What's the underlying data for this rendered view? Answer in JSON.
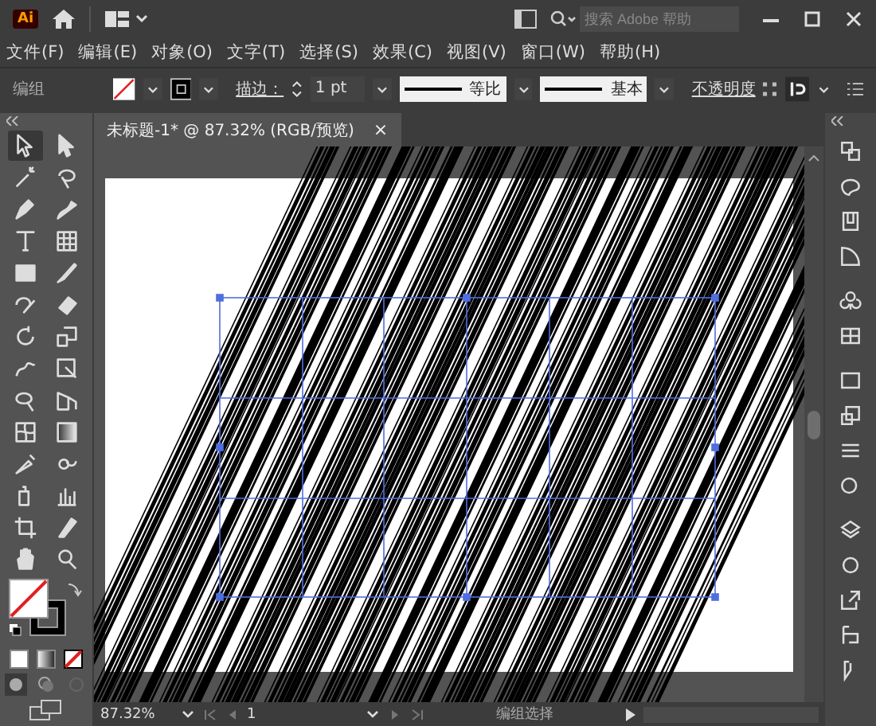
{
  "app": {
    "logo": "Ai",
    "search_placeholder": "搜索 Adobe 帮助"
  },
  "menu": [
    "文件(F)",
    "编辑(E)",
    "对象(O)",
    "文字(T)",
    "选择(S)",
    "效果(C)",
    "视图(V)",
    "窗口(W)",
    "帮助(H)"
  ],
  "control_bar": {
    "selection": "编组",
    "stroke_label": "描边：",
    "stroke_weight": "1 pt",
    "profile": "等比",
    "brush": "基本",
    "opacity_label": "不透明度"
  },
  "document_tab": {
    "title": "未标题-1* @ 87.32% (RGB/预览)",
    "close": "×"
  },
  "status_bar": {
    "zoom": "87.32%",
    "artboard": "1",
    "tool": "编组选择"
  }
}
